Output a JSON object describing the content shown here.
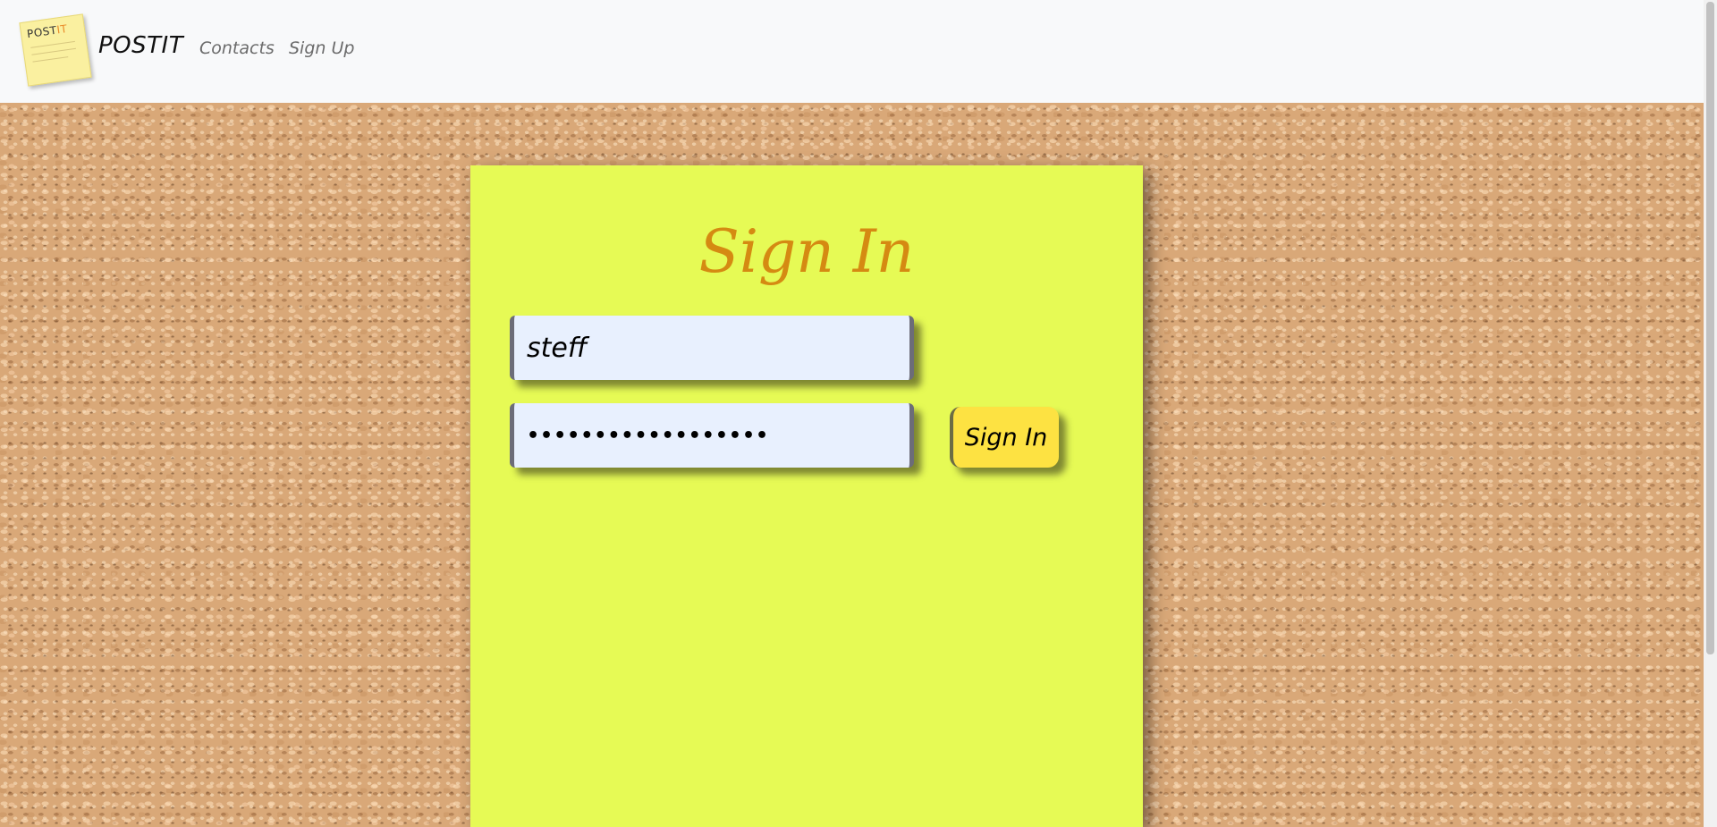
{
  "navbar": {
    "logo_text_main": "POST",
    "logo_text_accent": "IT",
    "brand": "POSTIT",
    "links": {
      "contacts": "Contacts",
      "sign_up": "Sign Up"
    }
  },
  "signin": {
    "title": "Sign In",
    "username_value": "steff",
    "password_value": "••••••••••••••••••",
    "button_label": "Sign In"
  },
  "colors": {
    "note_background": "#e6fa55",
    "title": "#d58a12",
    "button": "#fde242",
    "input_background": "#e8f0fe",
    "navbar": "#f8f9fa",
    "cork": "#d9a878"
  },
  "icons": {
    "logo": "sticky-note-logo-icon"
  }
}
